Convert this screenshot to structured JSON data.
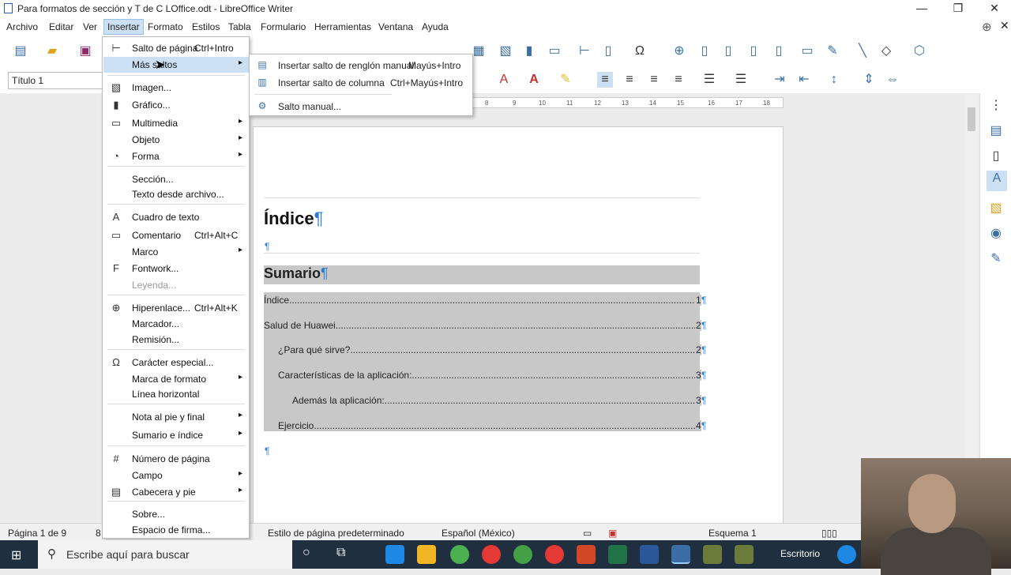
{
  "window": {
    "title": "Para formatos de sección y T  de C LOffice.odt - LibreOffice Writer"
  },
  "menubar": [
    "Archivo",
    "Editar",
    "Ver",
    "Insertar",
    "Formato",
    "Estilos",
    "Tabla",
    "Formulario",
    "Herramientas",
    "Ventana",
    "Ayuda"
  ],
  "toolbar": {
    "paragraph_style": "Título 1"
  },
  "insert_menu": [
    {
      "label": "Salto de página",
      "shortcut": "Ctrl+Intro",
      "icon": "page-break-icon"
    },
    {
      "label": "Más saltos",
      "arrow": true,
      "highlight": true
    },
    {
      "label": "Imagen...",
      "icon": "image-icon"
    },
    {
      "label": "Gráfico...",
      "icon": "chart-icon"
    },
    {
      "label": "Multimedia",
      "arrow": true,
      "icon": "media-icon"
    },
    {
      "label": "Objeto",
      "arrow": true
    },
    {
      "label": "Forma",
      "arrow": true,
      "icon": "shape-icon"
    },
    {
      "label": "Sección..."
    },
    {
      "label": "Texto desde archivo..."
    },
    {
      "label": "Cuadro de texto",
      "icon": "textbox-icon"
    },
    {
      "label": "Comentario",
      "shortcut": "Ctrl+Alt+C",
      "icon": "comment-icon"
    },
    {
      "label": "Marco",
      "arrow": true
    },
    {
      "label": "Fontwork...",
      "icon": "fontwork-icon"
    },
    {
      "label": "Leyenda...",
      "disabled": true
    },
    {
      "label": "Hiperenlace...",
      "shortcut": "Ctrl+Alt+K",
      "icon": "hyperlink-icon"
    },
    {
      "label": "Marcador..."
    },
    {
      "label": "Remisión..."
    },
    {
      "label": "Carácter especial...",
      "icon": "omega-icon"
    },
    {
      "label": "Marca de formato",
      "arrow": true
    },
    {
      "label": "Línea horizontal"
    },
    {
      "label": "Nota al pie y final",
      "arrow": true
    },
    {
      "label": "Sumario e índice",
      "arrow": true
    },
    {
      "label": "Número de página",
      "icon": "page-number-icon"
    },
    {
      "label": "Campo",
      "arrow": true
    },
    {
      "label": "Cabecera y pie",
      "arrow": true,
      "icon": "header-footer-icon"
    },
    {
      "label": "Sobre..."
    },
    {
      "label": "Espacio de firma..."
    }
  ],
  "sub_menu": [
    {
      "label": "Insertar salto de renglón manual",
      "shortcut": "Mayús+Intro"
    },
    {
      "label": "Insertar salto de columna",
      "shortcut": "Ctrl+Mayús+Intro"
    },
    {
      "label": "Salto manual..."
    }
  ],
  "document": {
    "heading": "Índice",
    "toc_title": "Sumario",
    "toc_entries": [
      {
        "text": "Índice",
        "page": "1",
        "indent": 0
      },
      {
        "text": "Salud de Huawei",
        "page": "2",
        "indent": 0
      },
      {
        "text": "¿Para qué sirve?",
        "page": "2",
        "indent": 1
      },
      {
        "text": "Características de la aplicación:",
        "page": "3",
        "indent": 1
      },
      {
        "text": "Además la aplicación:",
        "page": "3",
        "indent": 2
      },
      {
        "text": "Ejercicio",
        "page": "4",
        "indent": 1
      }
    ],
    "pilcrow": "¶"
  },
  "ruler_ticks": [
    "8",
    "9",
    "10",
    "11",
    "12",
    "13",
    "14",
    "15",
    "16",
    "17",
    "18"
  ],
  "statusbar": {
    "page": "Página 1 de 9",
    "words": "8",
    "page_style": "Estilo de página predeterminado",
    "language": "Español (México)",
    "outline": "Esquema 1"
  },
  "taskbar": {
    "search_placeholder": "Escribe aquí para buscar",
    "desktop": "Escritorio"
  }
}
